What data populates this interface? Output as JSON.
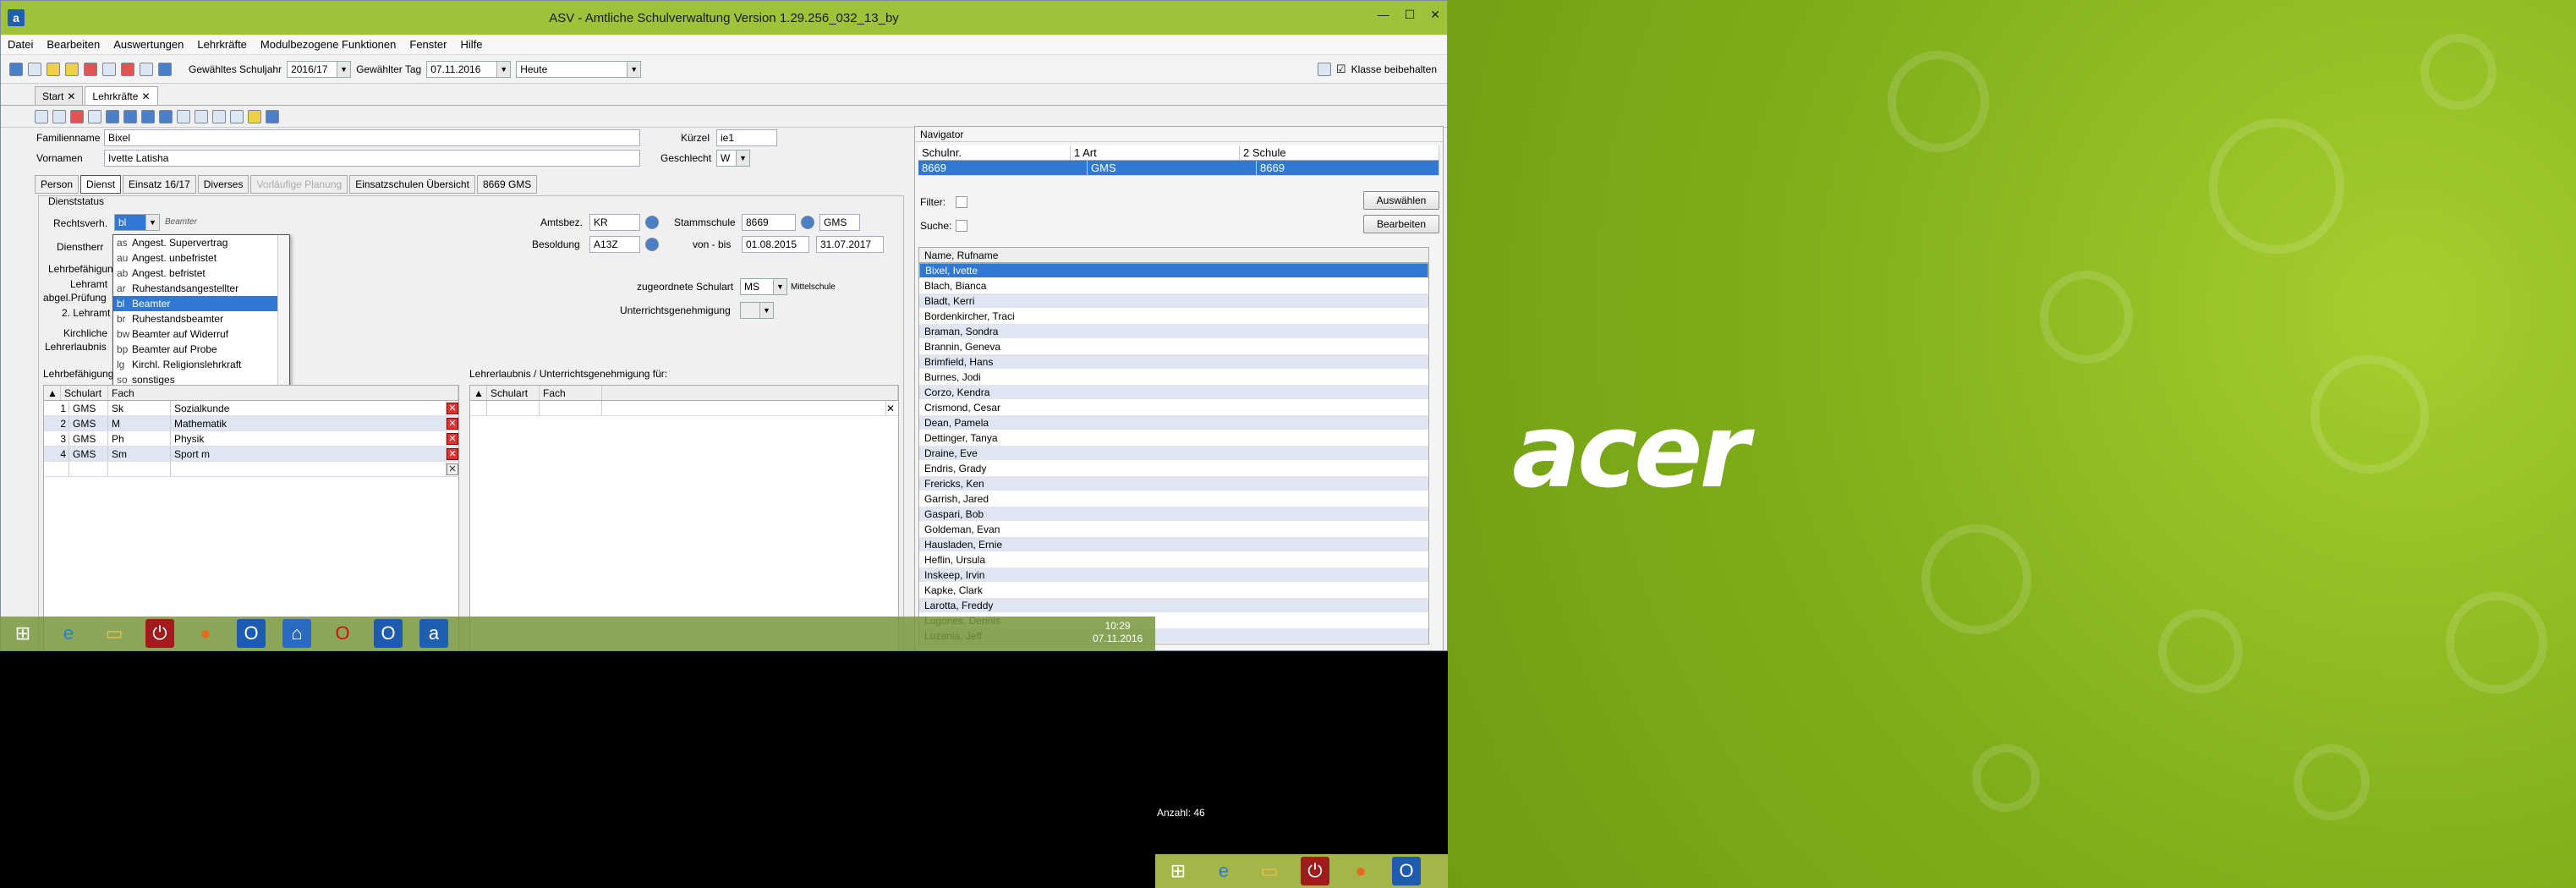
{
  "window": {
    "title": "ASV - Amtliche Schulverwaltung Version 1.29.256_032_13_by",
    "app_icon": "a",
    "min": "—",
    "max": "☐",
    "close": "✕"
  },
  "menu": [
    "Datei",
    "Bearbeiten",
    "Auswertungen",
    "Lehrkräfte",
    "Modulbezogene Funktionen",
    "Fenster",
    "Hilfe"
  ],
  "toolbar": {
    "schuljahr_label": "Gewähltes Schuljahr",
    "schuljahr_value": "2016/17",
    "tag_label": "Gewählter Tag",
    "tag_value": "07.11.2016",
    "heute_value": "Heute",
    "klasse_label": "Klasse beibehalten",
    "klasse_checked": "☑"
  },
  "tabs": [
    {
      "label": "Start",
      "close": "✕"
    },
    {
      "label": "Lehrkräfte",
      "close": "✕"
    }
  ],
  "form": {
    "familienname_label": "Familienname",
    "familienname_value": "Bixel",
    "vornamen_label": "Vornamen",
    "vornamen_value": "Ivette Latisha",
    "kuerzel_label": "Kürzel",
    "kuerzel_value": "ie1",
    "geschlecht_label": "Geschlecht",
    "geschlecht_value": "W"
  },
  "subtabs": [
    "Person",
    "Dienst",
    "Einsatz 16/17",
    "Diverses",
    "Vorläufige Planung",
    "Einsatzschulen Übersicht",
    "8669 GMS"
  ],
  "dienst": {
    "status_label": "Dienststatus",
    "rechtsverh_label": "Rechtsverh.",
    "rechtsverh_code": "bl",
    "rechtsverh_text": "Beamter",
    "dienstherr_label": "Dienstherr",
    "lehrbef_label": "Lehrbefähigung",
    "lehramt_label": "Lehramt",
    "abgel_label": "abgel.Prüfung",
    "zweiter_label": "2. Lehramt",
    "kirchl_label": "Kirchliche",
    "lehrerlaubnis_label": "Lehrerlaubnis",
    "lehrbef2_label": "Lehrbefähigung",
    "amtsbez_label": "Amtsbez.",
    "amtsbez_value": "KR",
    "besoldung_label": "Besoldung",
    "besoldung_value": "A13Z",
    "stammschule_label": "Stammschule",
    "stammschule_value": "8669",
    "stammschule_art": "GMS",
    "vonbis_label": "von - bis",
    "von_value": "01.08.2015",
    "bis_value": "31.07.2017",
    "zug_label": "zugeordnete Schulart",
    "zug_value": "MS",
    "zug_text": "Mittelschule",
    "unterricht_label": "Unterrichtsgenehmigung"
  },
  "dropdown": [
    {
      "code": "as",
      "text": "Angest. Supervertrag"
    },
    {
      "code": "au",
      "text": "Angest. unbefristet"
    },
    {
      "code": "ab",
      "text": "Angest. befristet"
    },
    {
      "code": "ar",
      "text": "Ruhestandsangestellter"
    },
    {
      "code": "bl",
      "text": "Beamter"
    },
    {
      "code": "br",
      "text": "Ruhestandsbeamter"
    },
    {
      "code": "bw",
      "text": "Beamter auf Widerruf"
    },
    {
      "code": "bp",
      "text": "Beamter auf Probe"
    },
    {
      "code": "lg",
      "text": "Kirchl. Religionslehrkraft"
    },
    {
      "code": "so",
      "text": "sonstiges"
    }
  ],
  "grid_left": {
    "headers": [
      "Schulart",
      "Fach"
    ],
    "rows": [
      {
        "n": "1",
        "schulart": "GMS",
        "code": "Sk",
        "fach": "Sozialkunde"
      },
      {
        "n": "2",
        "schulart": "GMS",
        "code": "M",
        "fach": "Mathematik"
      },
      {
        "n": "3",
        "schulart": "GMS",
        "code": "Ph",
        "fach": "Physik"
      },
      {
        "n": "4",
        "schulart": "GMS",
        "code": "Sm",
        "fach": "Sport m"
      }
    ]
  },
  "grid_right": {
    "title": "Lehrerlaubnis / Unterrichtsgenehmigung für:",
    "headers": [
      "Schulart",
      "Fach"
    ]
  },
  "navigator": {
    "title": "Navigator",
    "headers": [
      "Schulnr.",
      "1 Art",
      "2 Schule"
    ],
    "selected": {
      "nr": "8669",
      "art": "GMS",
      "schule": "8669"
    },
    "filter_label": "Filter:",
    "suche_label": "Suche:",
    "auswaehlen": "Auswählen",
    "bearbeiten": "Bearbeiten",
    "list_header": "Name, Rufname",
    "names": [
      "Bixel, Ivette",
      "Blach, Bianca",
      "Bladt, Kerri",
      "Bordenkircher, Traci",
      "Braman, Sondra",
      "Brannin, Geneva",
      "Brimfield, Hans",
      "Burnes, Jodi",
      "Corzo, Kendra",
      "Crismond, Cesar",
      "Dean, Pamela",
      "Dettinger, Tanya",
      "Draine, Eve",
      "Endris, Grady",
      "Frericks, Ken",
      "Garrish, Jared",
      "Gaspari, Bob",
      "Goldeman, Evan",
      "Hausladen, Ernie",
      "Heflin, Ursula",
      "Inskeep, Irvin",
      "Kapke, Clark",
      "Larotta, Freddy",
      "Lugones, Dennis",
      "Luzania, Jeff"
    ],
    "anzahl": "Anzahl: 46"
  },
  "taskbar1": {
    "time": "10:29",
    "date": "07.11.2016"
  },
  "desktop": {
    "brand": "acer"
  }
}
